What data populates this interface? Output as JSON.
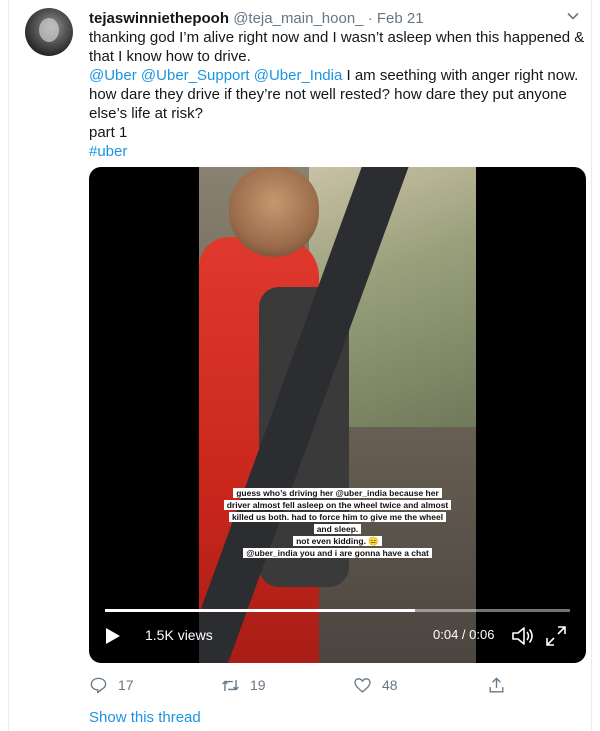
{
  "tweet": {
    "display_name": "tejaswinniethepooh",
    "handle": "@teja_main_hoon_",
    "separator": "·",
    "date": "Feb 21",
    "text_line1": "thanking god I’m alive right now and I wasn’t asleep when this happened & that I know how to drive.",
    "mentions": [
      "@Uber",
      "@Uber_Support",
      "@Uber_India"
    ],
    "text_line2": " I am seething with anger right now. how dare they drive if they’re not well rested? how dare they put anyone else’s life at risk?",
    "text_line3": "part 1",
    "hashtag": "#uber"
  },
  "video": {
    "caption_lines": [
      "guess who’s driving her @uber_india because her",
      "driver almost fell asleep on the wheel twice and almost",
      "killed us both. had to force him to give me the wheel",
      "and sleep.",
      "not even kidding. 😑",
      "@uber_india you and i are gonna have a chat"
    ],
    "views": "1.5K views",
    "time": "0:04 / 0:06",
    "progress": 0.667,
    "icons": {
      "play": "play-icon",
      "volume": "volume-icon",
      "fullscreen": "fullscreen-icon"
    }
  },
  "actions": {
    "replies": "17",
    "retweets": "19",
    "likes": "48"
  },
  "show_thread": "Show this thread",
  "colors": {
    "link": "#1b95e0",
    "muted": "#657786",
    "text": "#14171a"
  }
}
